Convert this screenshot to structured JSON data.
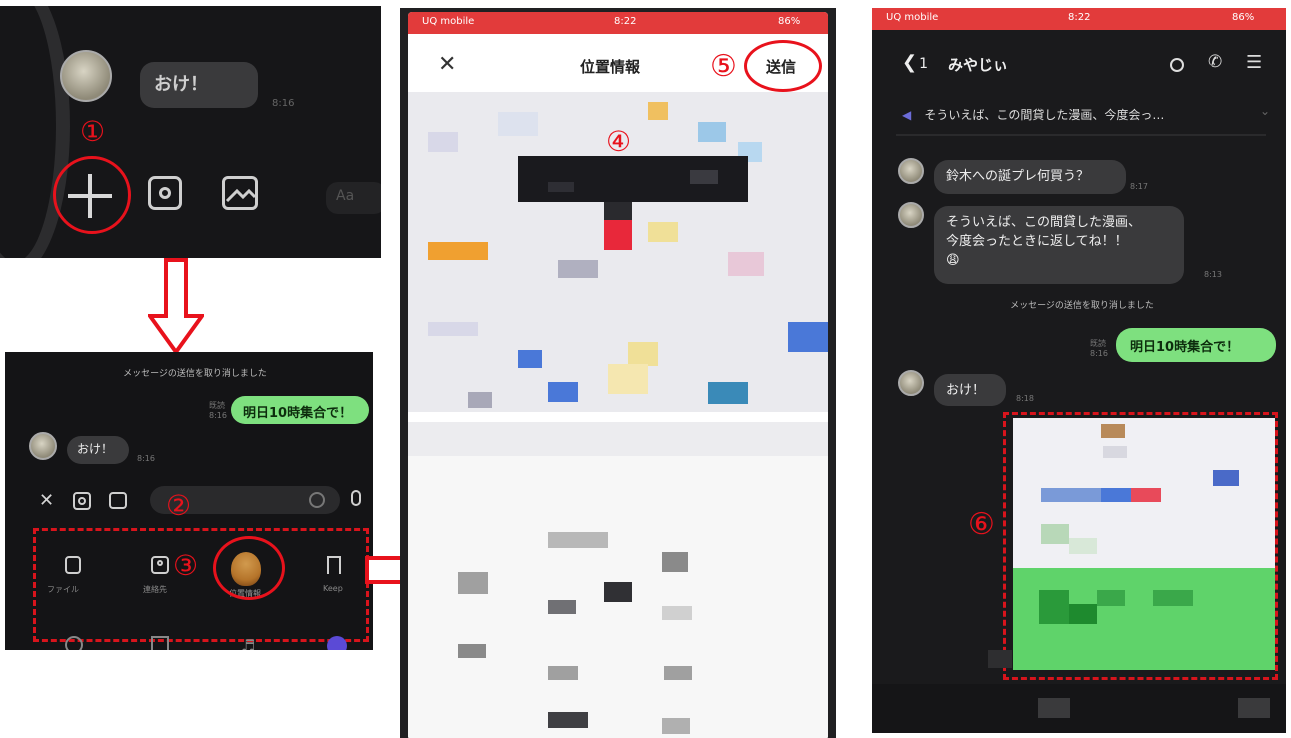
{
  "markers": {
    "m1": "①",
    "m2": "②",
    "m3": "③",
    "m4": "④",
    "m5": "⑤",
    "m6": "⑥"
  },
  "panel1": {
    "message": "おけ！"
  },
  "panel2": {
    "system_notice": "メッセージの送信を取り消しました",
    "sent_message": "明日10時集合で！",
    "received_message": "おけ！",
    "menu": [
      "ファイル",
      "連絡先",
      "位置情報",
      "Keep"
    ]
  },
  "panel3": {
    "title": "位置情報",
    "send_button": "送信",
    "status": {
      "carrier": "UQ mobile",
      "time": "8:22",
      "battery": "86%"
    }
  },
  "panel4": {
    "status": {
      "carrier": "UQ mobile",
      "time": "8:22",
      "battery": "86%"
    },
    "back_count": "1",
    "chat_name": "みやじぃ",
    "announcement": "そういえば、この間貸した漫画、今度会っ…",
    "messages": {
      "m1": "鈴木への誕プレ何買う？",
      "m2_line1": "そういえば、この間貸した漫画、",
      "m2_line2": "今度会ったときに返してね！！",
      "m2_emoji": "😩",
      "system": "メッセージの送信を取り消しました",
      "sent": "明日10時集合で！",
      "reply": "おけ！"
    }
  },
  "colors": {
    "accent_red": "#e8121c",
    "line_green": "#7ee07f",
    "dark_bg": "#1b1b1d"
  }
}
